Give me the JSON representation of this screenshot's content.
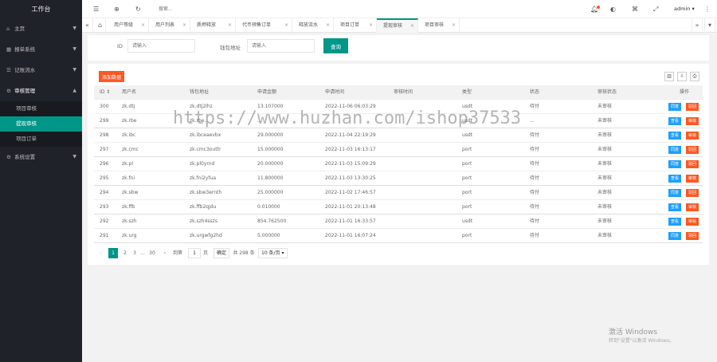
{
  "sidebar": {
    "title": "工作台",
    "menu": [
      {
        "label": "主页",
        "icon": "home-icon"
      },
      {
        "label": "报单系统",
        "icon": "grid-icon"
      },
      {
        "label": "记账流水",
        "icon": "list-icon"
      },
      {
        "label": "审核管理",
        "icon": "gear-icon"
      }
    ],
    "submenu": [
      "项目审核",
      "提现审核",
      "项目订单"
    ],
    "last": {
      "label": "系统设置",
      "icon": "settings-icon"
    }
  },
  "header": {
    "search_placeholder": "搜索...",
    "user": "admin"
  },
  "tabs": [
    "用户等级",
    "用户列表",
    "质押释放",
    "代币预售订单",
    "释放流水",
    "项目订单",
    "提现审核",
    "项目审核"
  ],
  "search": {
    "id_label": "ID",
    "id_placeholder": "请输入",
    "addr_label": "钱包地址",
    "addr_placeholder": "请输入",
    "query_label": "查询"
  },
  "table": {
    "add_label": "添加数据",
    "columns": [
      "ID",
      "用户名",
      "钱包地址",
      "申请金额",
      "申请时间",
      "审核时间",
      "类型",
      "状态",
      "审核状态",
      "操作"
    ],
    "rows": [
      {
        "id": "300",
        "user": "zk.dtj",
        "addr": "zk.dtj2lhz",
        "amount": "13.107000",
        "time": "2022-11-06 06:03:29",
        "audit": "",
        "type": "usdt",
        "status": "待付",
        "astatus": "未审核",
        "b1": "同意",
        "b2": "驳回",
        "c1": "blue",
        "c2": "red"
      },
      {
        "id": "299",
        "user": "zk.rbe",
        "addr": "zk.rbe...",
        "amount": "...",
        "time": "...",
        "audit": "",
        "type": "usdt",
        "status": "...",
        "astatus": "未审核",
        "b1": "查看",
        "b2": "审核",
        "c1": "blue",
        "c2": "red"
      },
      {
        "id": "298",
        "user": "zk.ibc",
        "addr": "zk.ibceaevbx",
        "amount": "29.000000",
        "time": "2022-11-04 22:19:29",
        "audit": "",
        "type": "usdt",
        "status": "待付",
        "astatus": "未审核",
        "b1": "查看",
        "b2": "审核",
        "c1": "blue",
        "c2": "red"
      },
      {
        "id": "297",
        "user": "zk.cmc",
        "addr": "zk.cmc3outtr",
        "amount": "15.000000",
        "time": "2022-11-03 16:13:17",
        "audit": "",
        "type": "port",
        "status": "待付",
        "astatus": "未审核",
        "b1": "同意",
        "b2": "驳回",
        "c1": "blue",
        "c2": "red"
      },
      {
        "id": "296",
        "user": "zk.pl",
        "addr": "zk.pl0yrnd",
        "amount": "20.000000",
        "time": "2022-11-03 15:09:29",
        "audit": "",
        "type": "port",
        "status": "待付",
        "astatus": "未审核",
        "b1": "同意",
        "b2": "驳回",
        "c1": "blue",
        "c2": "red"
      },
      {
        "id": "295",
        "user": "zk.fni",
        "addr": "zk.fni2yfua",
        "amount": "11.800000",
        "time": "2022-11-03 13:30:25",
        "audit": "",
        "type": "port",
        "status": "待付",
        "astatus": "未审核",
        "b1": "查看",
        "b2": "审核",
        "c1": "blue",
        "c2": "red"
      },
      {
        "id": "294",
        "user": "zk.sbw",
        "addr": "zk.sbw3ernth",
        "amount": "25.000000",
        "time": "2022-11-02 17:46:57",
        "audit": "",
        "type": "port",
        "status": "待付",
        "astatus": "未审核",
        "b1": "同意",
        "b2": "驳回",
        "c1": "blue",
        "c2": "red"
      },
      {
        "id": "293",
        "user": "zk.ffb",
        "addr": "zk.ffb2qjdu",
        "amount": "0.010000",
        "time": "2022-11-01 20:13:48",
        "audit": "",
        "type": "port",
        "status": "待付",
        "astatus": "未审核",
        "b1": "查看",
        "b2": "审核",
        "c1": "blue",
        "c2": "red"
      },
      {
        "id": "292",
        "user": "zk.szh",
        "addr": "zk.szh4sszs",
        "amount": "854.762500",
        "time": "2022-11-01 16:33:57",
        "audit": "",
        "type": "usdt",
        "status": "待付",
        "astatus": "未审核",
        "b1": "查看",
        "b2": "审核",
        "c1": "blue",
        "c2": "red"
      },
      {
        "id": "291",
        "user": "zk.urg",
        "addr": "zk.urgwfg2hd",
        "amount": "5.000000",
        "time": "2022-11-01 16:07:24",
        "audit": "",
        "type": "port",
        "status": "待付",
        "astatus": "未审核",
        "b1": "同意",
        "b2": "驳回",
        "c1": "blue",
        "c2": "red"
      }
    ]
  },
  "pager": {
    "pages": [
      "1",
      "2",
      "3",
      "...",
      "30"
    ],
    "goto_label": "到第",
    "goto_value": "1",
    "page_unit": "页",
    "confirm": "确定",
    "total": "共 298 条",
    "per_page": "10 条/页"
  },
  "watermark": "https://www.huzhan.com/ishop37533",
  "windows": {
    "line1": "激活 Windows",
    "line2": "转到\"设置\"以激活 Windows。"
  }
}
